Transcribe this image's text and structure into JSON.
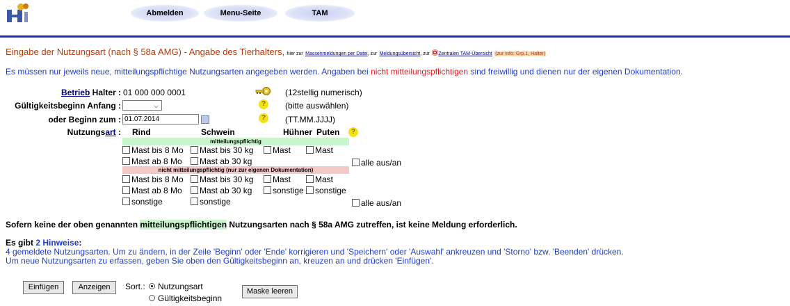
{
  "header": {
    "nav": [
      "Abmelden",
      "Menu-Seite",
      "TAM"
    ]
  },
  "title": {
    "main": "Eingabe der Nutzungsart (nach § 58a AMG) - Angabe des Tierhalters,",
    "s1": "hier zur",
    "link1": "Massenmeldungen per Datei",
    "s2": ", zur",
    "link2": "Meldungsübersicht",
    "s3": ", zur",
    "link3": "Zentralen TAM-Übersicht",
    "grp": "(zur Info: Grp.1, Halter)"
  },
  "intro": {
    "a": "Es müssen nur jeweils neue, mitteilungspflichtige Nutzungsarten angegeben werden. Angaben bei",
    "red": "nicht mitteilungspflichtigen",
    "b": "sind freiwillig und dienen nur der eigenen Dokumentation."
  },
  "form": {
    "betrieb_link": "Betrieb",
    "halter_label": "Halter :",
    "halter_value": "01 000 000 0001",
    "halter_hint": "(12stellig numerisch)",
    "gueltig_label": "Gültigkeitsbeginn Anfang :",
    "gueltig_hint": "(bitte auswählen)",
    "beginn_label": "oder Beginn zum :",
    "beginn_value": "01.07.2014",
    "beginn_hint": "(TT.MM.JJJJ)",
    "nutzung_a": "Nutzungs",
    "nutzung_link": "art",
    "nutzung_colon": " :"
  },
  "columns": [
    "Rind",
    "Schwein",
    "Hühner",
    "Puten"
  ],
  "bands": {
    "green": "mitteilungspflichtig",
    "red": "nicht mitteilungspflichtig (nur zur eigenen Dokumentation)"
  },
  "checks": {
    "mast_bis_8": "Mast bis 8 Mo",
    "mast_ab_8": "Mast ab 8 Mo",
    "mast_bis_30": "Mast bis 30 kg",
    "mast_ab_30": "Mast ab 30 kg",
    "mast": "Mast",
    "sonstige": "sonstige",
    "alle": "alle aus/an"
  },
  "note": {
    "a": "Sofern keine der oben genannten",
    "hl": "mitteilungspflichtigen",
    "b": "Nutzungsarten nach § 58a AMG zutreffen, ist keine Meldung erforderlich."
  },
  "hints": {
    "prefix": "Es gibt",
    "count": "2 Hinweise",
    "suffix": ":",
    "line1": "4 gemeldete Nutzungsarten. Um zu ändern, in der Zeile 'Beginn' oder 'Ende' korrigieren und 'Speichern' oder 'Auswahl' ankreuzen und 'Storno' bzw. 'Beenden' drücken.",
    "line2": "Um neue Nutzungsarten zu erfassen, geben Sie oben den Gültigkeitsbeginn an, kreuzen an und drücken 'Einfügen'."
  },
  "actions": {
    "insert": "Einfügen",
    "show": "Anzeigen",
    "sort_label": "Sort.:",
    "sort_opt1": "Nutzungsart",
    "sort_opt2": "Gültigkeitsbeginn",
    "clear": "Maske leeren"
  }
}
